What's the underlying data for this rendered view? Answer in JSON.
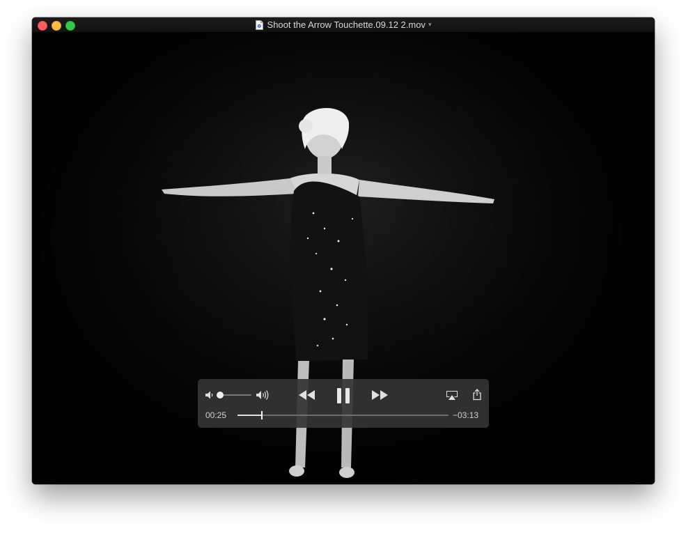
{
  "window": {
    "title": "Shoot the Arrow Touchette.09.12 2.mov"
  },
  "icons": {
    "file": "movie-file-icon",
    "title_menu": "chevron-down-icon",
    "volume_low": "speaker-low-icon",
    "volume_high": "speaker-high-icon",
    "rewind": "rewind-icon",
    "pause": "pause-icon",
    "fast_forward": "fast-forward-icon",
    "airplay": "airplay-icon",
    "share": "share-icon"
  },
  "controls": {
    "elapsed": "00:25",
    "remaining": "−03:13",
    "volume_level": 0.0,
    "progress": 0.117
  },
  "colors": {
    "close": "#fc605c",
    "minimize": "#fdbc40",
    "zoom": "#34c84a"
  }
}
